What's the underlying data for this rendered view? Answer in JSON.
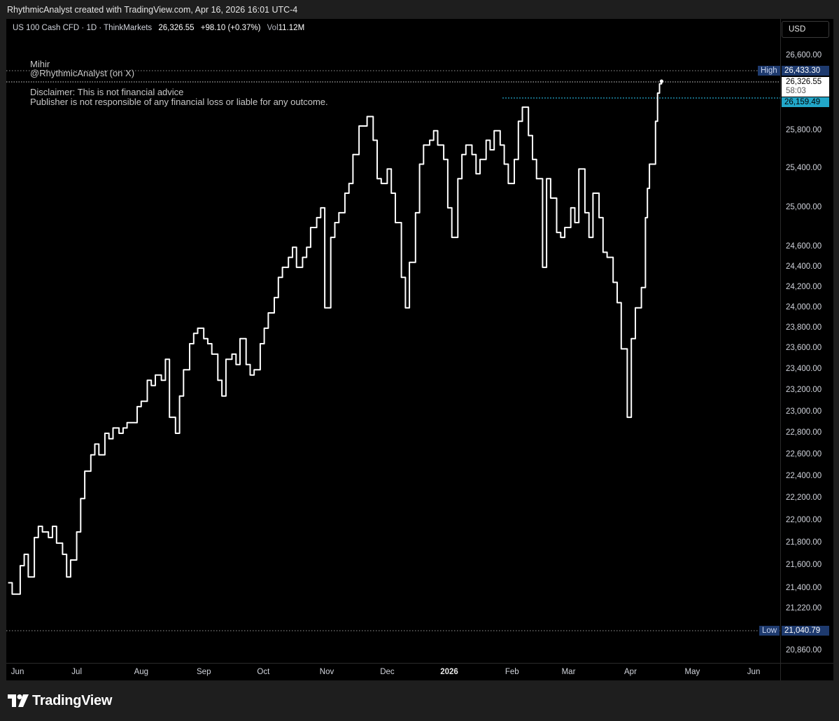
{
  "header": {
    "caption": "RhythmicAnalyst created with TradingView.com, Apr 16, 2026 16:01 UTC-4"
  },
  "legend": {
    "symbol": "US 100 Cash CFD · 1D · ThinkMarkets",
    "last": "26,326.55",
    "change": "+98.10 (+0.37%)",
    "vol_label": "Vol",
    "vol_value": "11.12M"
  },
  "notes": {
    "name": "Mihir",
    "handle": "@RhythmicAnalyst (on X)",
    "disclaimer_1": "Disclaimer: This is not financial advice",
    "disclaimer_2": "Publisher is not responsible of any financial loss or liable for any outcome."
  },
  "currency_button": "USD",
  "price_tags": {
    "high_label": "High",
    "high_value": "26,433.30",
    "current_value": "26,326.55",
    "countdown": "58:03",
    "line_value": "26,159.49",
    "low_label": "Low",
    "low_value": "21,040.79"
  },
  "brand": "TradingView",
  "colors": {
    "line": "#ffffff",
    "background": "#000000",
    "cyan": "#22a7c9",
    "tag_blue": "#1e3a6e"
  },
  "chart_data": {
    "type": "line",
    "title": "US 100 Cash CFD · 1D · ThinkMarkets",
    "y_scale": "log",
    "ylim": [
      20750,
      26750
    ],
    "y_ticks": [
      {
        "label": "26,600.00",
        "value": 26600
      },
      {
        "label": "25,800.00",
        "value": 25800
      },
      {
        "label": "25,400.00",
        "value": 25400
      },
      {
        "label": "25,000.00",
        "value": 25000
      },
      {
        "label": "24,600.00",
        "value": 24600
      },
      {
        "label": "24,400.00",
        "value": 24400
      },
      {
        "label": "24,200.00",
        "value": 24200
      },
      {
        "label": "24,000.00",
        "value": 24000
      },
      {
        "label": "23,800.00",
        "value": 23800
      },
      {
        "label": "23,600.00",
        "value": 23600
      },
      {
        "label": "23,400.00",
        "value": 23400
      },
      {
        "label": "23,200.00",
        "value": 23200
      },
      {
        "label": "23,000.00",
        "value": 23000
      },
      {
        "label": "22,800.00",
        "value": 22800
      },
      {
        "label": "22,600.00",
        "value": 22600
      },
      {
        "label": "22,400.00",
        "value": 22400
      },
      {
        "label": "22,200.00",
        "value": 22200
      },
      {
        "label": "22,000.00",
        "value": 22000
      },
      {
        "label": "21,800.00",
        "value": 21800
      },
      {
        "label": "21,600.00",
        "value": 21600
      },
      {
        "label": "21,400.00",
        "value": 21400
      },
      {
        "label": "21,220.00",
        "value": 21220
      },
      {
        "label": "20,860.00",
        "value": 20860
      }
    ],
    "x_ticks": [
      {
        "label": "Jun",
        "date": "2025-06-01"
      },
      {
        "label": "Jul",
        "date": "2025-07-01"
      },
      {
        "label": "Aug",
        "date": "2025-08-01"
      },
      {
        "label": "Sep",
        "date": "2025-09-01"
      },
      {
        "label": "Oct",
        "date": "2025-10-01"
      },
      {
        "label": "Nov",
        "date": "2025-11-01"
      },
      {
        "label": "Dec",
        "date": "2025-12-01"
      },
      {
        "label": "2026",
        "date": "2026-01-01",
        "bold": true
      },
      {
        "label": "Feb",
        "date": "2026-02-01"
      },
      {
        "label": "Mar",
        "date": "2026-03-01"
      },
      {
        "label": "Apr",
        "date": "2026-04-01"
      },
      {
        "label": "May",
        "date": "2026-05-01"
      },
      {
        "label": "Jun",
        "date": "2026-06-01"
      }
    ],
    "x_range": [
      "2025-05-27",
      "2026-06-15"
    ],
    "high": 26433.3,
    "low": 21040.79,
    "last": 26326.55,
    "series": [
      {
        "values": [
          [
            "2025-05-27",
            21450
          ],
          [
            "2025-05-29",
            21350
          ],
          [
            "2025-06-02",
            21600
          ],
          [
            "2025-06-04",
            21700
          ],
          [
            "2025-06-06",
            21500
          ],
          [
            "2025-06-09",
            21850
          ],
          [
            "2025-06-11",
            21950
          ],
          [
            "2025-06-13",
            21900
          ],
          [
            "2025-06-16",
            21850
          ],
          [
            "2025-06-18",
            21950
          ],
          [
            "2025-06-20",
            21800
          ],
          [
            "2025-06-23",
            21700
          ],
          [
            "2025-06-25",
            21500
          ],
          [
            "2025-06-27",
            21650
          ],
          [
            "2025-06-30",
            21900
          ],
          [
            "2025-07-02",
            22200
          ],
          [
            "2025-07-04",
            22450
          ],
          [
            "2025-07-07",
            22600
          ],
          [
            "2025-07-09",
            22700
          ],
          [
            "2025-07-11",
            22600
          ],
          [
            "2025-07-14",
            22800
          ],
          [
            "2025-07-16",
            22750
          ],
          [
            "2025-07-18",
            22850
          ],
          [
            "2025-07-21",
            22800
          ],
          [
            "2025-07-23",
            22850
          ],
          [
            "2025-07-25",
            22900
          ],
          [
            "2025-07-28",
            22900
          ],
          [
            "2025-07-30",
            23050
          ],
          [
            "2025-08-01",
            23100
          ],
          [
            "2025-08-04",
            23300
          ],
          [
            "2025-08-06",
            23250
          ],
          [
            "2025-08-08",
            23350
          ],
          [
            "2025-08-11",
            23300
          ],
          [
            "2025-08-13",
            23500
          ],
          [
            "2025-08-15",
            22950
          ],
          [
            "2025-08-18",
            22800
          ],
          [
            "2025-08-20",
            23150
          ],
          [
            "2025-08-22",
            23400
          ],
          [
            "2025-08-25",
            23650
          ],
          [
            "2025-08-27",
            23750
          ],
          [
            "2025-08-29",
            23800
          ],
          [
            "2025-09-01",
            23700
          ],
          [
            "2025-09-03",
            23650
          ],
          [
            "2025-09-05",
            23550
          ],
          [
            "2025-09-08",
            23300
          ],
          [
            "2025-09-10",
            23150
          ],
          [
            "2025-09-12",
            23500
          ],
          [
            "2025-09-15",
            23550
          ],
          [
            "2025-09-17",
            23450
          ],
          [
            "2025-09-19",
            23700
          ],
          [
            "2025-09-22",
            23450
          ],
          [
            "2025-09-24",
            23350
          ],
          [
            "2025-09-26",
            23400
          ],
          [
            "2025-09-29",
            23650
          ],
          [
            "2025-10-01",
            23800
          ],
          [
            "2025-10-03",
            23950
          ],
          [
            "2025-10-06",
            24100
          ],
          [
            "2025-10-08",
            24300
          ],
          [
            "2025-10-10",
            24400
          ],
          [
            "2025-10-13",
            24500
          ],
          [
            "2025-10-15",
            24600
          ],
          [
            "2025-10-17",
            24400
          ],
          [
            "2025-10-20",
            24500
          ],
          [
            "2025-10-22",
            24600
          ],
          [
            "2025-10-24",
            24800
          ],
          [
            "2025-10-27",
            24900
          ],
          [
            "2025-10-29",
            25000
          ],
          [
            "2025-10-31",
            24000
          ],
          [
            "2025-11-03",
            24700
          ],
          [
            "2025-11-05",
            24850
          ],
          [
            "2025-11-07",
            24950
          ],
          [
            "2025-11-10",
            25150
          ],
          [
            "2025-11-12",
            25250
          ],
          [
            "2025-11-14",
            25550
          ],
          [
            "2025-11-17",
            25850
          ],
          [
            "2025-11-19",
            25850
          ],
          [
            "2025-11-21",
            25950
          ],
          [
            "2025-11-24",
            25700
          ],
          [
            "2025-11-26",
            25300
          ],
          [
            "2025-11-28",
            25250
          ],
          [
            "2025-12-01",
            25400
          ],
          [
            "2025-12-03",
            25150
          ],
          [
            "2025-12-05",
            24850
          ],
          [
            "2025-12-08",
            24300
          ],
          [
            "2025-12-10",
            24000
          ],
          [
            "2025-12-12",
            24450
          ],
          [
            "2025-12-15",
            24950
          ],
          [
            "2025-12-17",
            25450
          ],
          [
            "2025-12-19",
            25650
          ],
          [
            "2025-12-22",
            25700
          ],
          [
            "2025-12-24",
            25800
          ],
          [
            "2025-12-26",
            25650
          ],
          [
            "2025-12-29",
            25500
          ],
          [
            "2025-12-31",
            25000
          ],
          [
            "2026-01-02",
            24700
          ],
          [
            "2026-01-05",
            25300
          ],
          [
            "2026-01-07",
            25550
          ],
          [
            "2026-01-09",
            25650
          ],
          [
            "2026-01-12",
            25550
          ],
          [
            "2026-01-14",
            25350
          ],
          [
            "2026-01-16",
            25500
          ],
          [
            "2026-01-19",
            25700
          ],
          [
            "2026-01-21",
            25600
          ],
          [
            "2026-01-23",
            25800
          ],
          [
            "2026-01-26",
            25650
          ],
          [
            "2026-01-28",
            25450
          ],
          [
            "2026-01-30",
            25250
          ],
          [
            "2026-02-02",
            25500
          ],
          [
            "2026-02-04",
            25900
          ],
          [
            "2026-02-06",
            26050
          ],
          [
            "2026-02-09",
            25750
          ],
          [
            "2026-02-11",
            25500
          ],
          [
            "2026-02-13",
            25300
          ],
          [
            "2026-02-16",
            24400
          ],
          [
            "2026-02-18",
            25300
          ],
          [
            "2026-02-20",
            25100
          ],
          [
            "2026-02-23",
            24750
          ],
          [
            "2026-02-25",
            24700
          ],
          [
            "2026-02-27",
            24800
          ],
          [
            "2026-03-02",
            25000
          ],
          [
            "2026-03-04",
            24850
          ],
          [
            "2026-03-06",
            25400
          ],
          [
            "2026-03-09",
            24950
          ],
          [
            "2026-03-11",
            24700
          ],
          [
            "2026-03-13",
            25150
          ],
          [
            "2026-03-16",
            24900
          ],
          [
            "2026-03-18",
            24550
          ],
          [
            "2026-03-20",
            24500
          ],
          [
            "2026-03-23",
            24250
          ],
          [
            "2026-03-25",
            24050
          ],
          [
            "2026-03-27",
            23600
          ],
          [
            "2026-03-30",
            22950
          ],
          [
            "2026-04-01",
            23700
          ],
          [
            "2026-04-03",
            24000
          ],
          [
            "2026-04-06",
            24200
          ],
          [
            "2026-04-08",
            24900
          ],
          [
            "2026-04-09",
            25200
          ],
          [
            "2026-04-10",
            25450
          ],
          [
            "2026-04-13",
            25900
          ],
          [
            "2026-04-14",
            26200
          ],
          [
            "2026-04-15",
            26300
          ],
          [
            "2026-04-16",
            26326.55
          ]
        ]
      }
    ]
  }
}
